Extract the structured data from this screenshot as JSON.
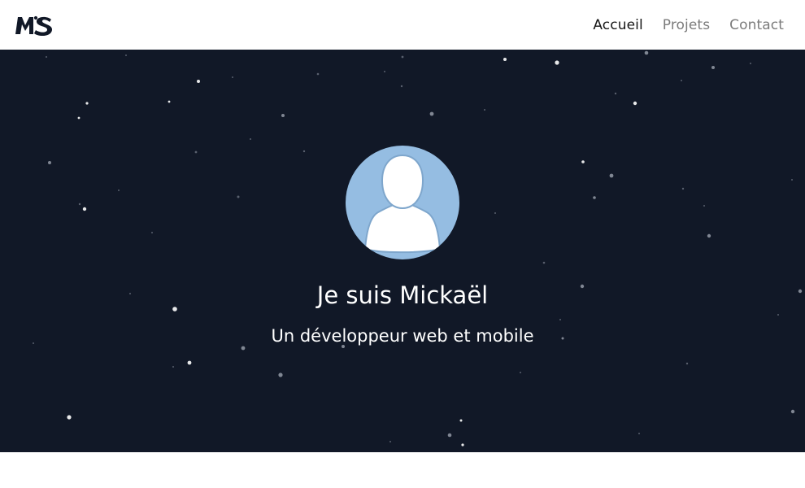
{
  "brand": {
    "logo_text": "MS"
  },
  "nav": {
    "items": [
      {
        "label": "Accueil",
        "active": true
      },
      {
        "label": "Projets",
        "active": false
      },
      {
        "label": "Contact",
        "active": false
      }
    ]
  },
  "hero": {
    "title": "Je suis Mickaël",
    "subtitle": "Un développeur web et mobile",
    "avatar_icon": "user-avatar-icon"
  },
  "colors": {
    "hero_background": "#111827",
    "avatar_background": "#95bde2",
    "nav_active": "#161616",
    "nav_inactive": "#7b7b7b",
    "text_light": "#ffffff"
  }
}
